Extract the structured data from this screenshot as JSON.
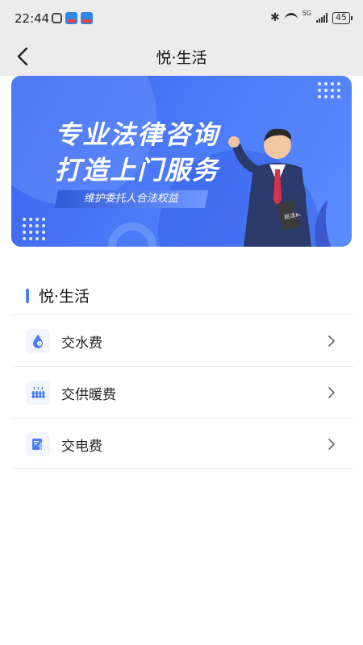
{
  "status_bar": {
    "time": "22:44",
    "network": "5G",
    "battery": "45"
  },
  "nav": {
    "title": "悦·生活"
  },
  "banner": {
    "headline_line1": "专业法律咨询",
    "headline_line2": "打造上门服务",
    "tagline": "维护委托人合法权益",
    "book_label": "民法典"
  },
  "section": {
    "title": "悦·生活"
  },
  "services": [
    {
      "label": "交水费",
      "icon": "water-drop-icon"
    },
    {
      "label": "交供暖费",
      "icon": "heating-radiator-icon"
    },
    {
      "label": "交电费",
      "icon": "electricity-bill-icon"
    }
  ],
  "colors": {
    "accent": "#4c7cf6",
    "banner_blue": "#3a63ee",
    "header_bg": "#ececec"
  }
}
